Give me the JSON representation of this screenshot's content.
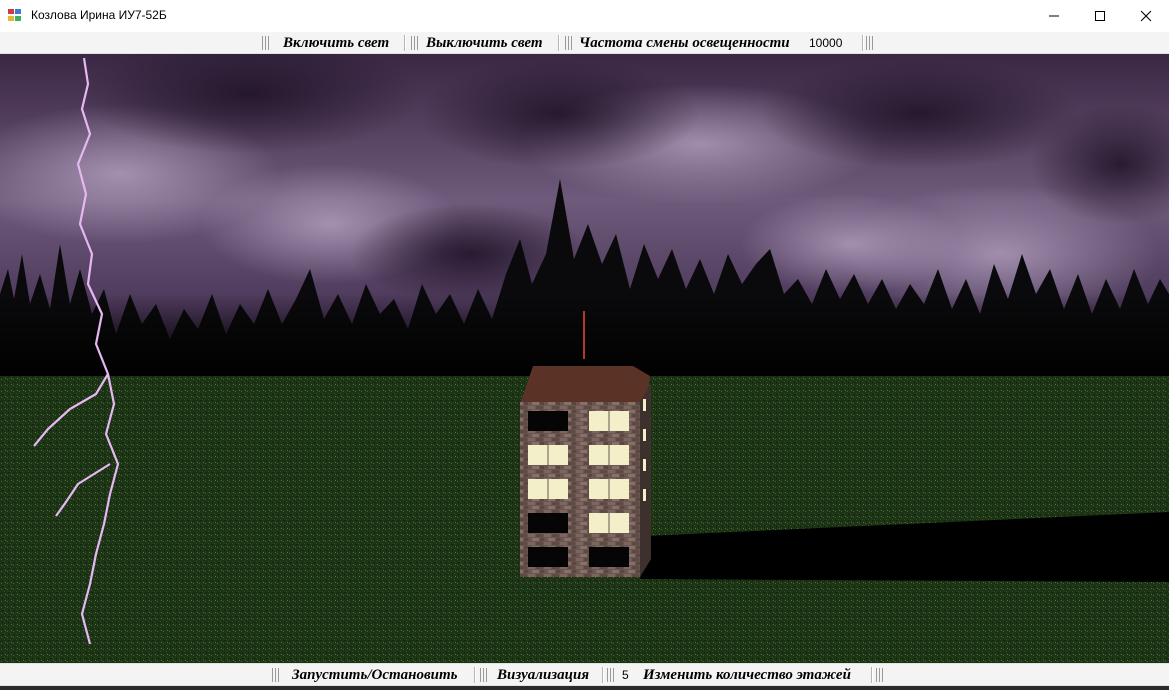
{
  "window": {
    "title": "Козлова Ирина ИУ7-52Б",
    "minimize_icon": "minimize-icon",
    "maximize_icon": "maximize-icon",
    "close_icon": "close-icon"
  },
  "top_toolbar": {
    "light_on": "Включить свет",
    "light_off": "Выключить свет",
    "frequency_label": "Частота смены освещенности",
    "frequency_value": "10000"
  },
  "bottom_toolbar": {
    "start_stop": "Запустить/Остановить",
    "visualization": "Визуализация",
    "floors_value": "5",
    "change_floors": "Изменить количество этажей"
  },
  "colors": {
    "sky_dark": "#2a1a33",
    "sky_purple": "#6b4f78",
    "grass": "#1f3a1a",
    "roof": "#5a3326",
    "brick": "#6a5550",
    "window_lit": "#f5f0c8",
    "window_dark": "#050505",
    "lightning": "#e6b8f2"
  }
}
